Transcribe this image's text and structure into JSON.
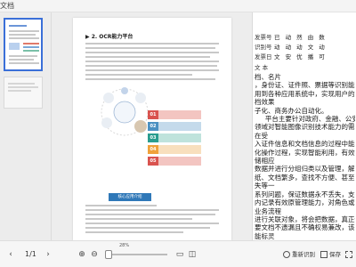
{
  "window": {
    "title": "文档"
  },
  "document": {
    "heading": "▶ 2. OCR能力平台",
    "blue_label": "核心应用介绍",
    "bars": [
      {
        "num": "01",
        "color": "#d9534f"
      },
      {
        "num": "02",
        "color": "#4a90c2"
      },
      {
        "num": "03",
        "color": "#2a9d8f"
      },
      {
        "num": "04",
        "color": "#f0a23b"
      },
      {
        "num": "05",
        "color": "#d9534f"
      }
    ]
  },
  "ocr": {
    "fields": [
      {
        "label": "发票号",
        "values": "已 动 然 由 数"
      },
      {
        "label": "识别号",
        "values": "动 动 动 文 动"
      },
      {
        "label": "发票日",
        "values": "文 安 优 播 可"
      }
    ],
    "text_label": "文 本",
    "text_lines": [
      "档、名片",
      "，身份证、证件照、票据等识别能力",
      "用到各种应用系统中，实现用户的文",
      "档效果",
      "子化、商务办公自动化。",
      "     平台主要针对政府、金融、公安等",
      "领域对智能图像识别技术能力的需求",
      "在受",
      "入证件信息和文档信息的过程中能",
      "化操作过程，实现智能利用，有效提",
      "储相应",
      "数据并进行分组归类以及管理，解决",
      "纸、文档繁多，查找不方便、甚至",
      "失等一",
      "系列问题，保证数据永不丢失，支持",
      "内记录有效原管理能力，对角色或",
      "业务流程",
      "进行关联对象，将会把数据，真正做",
      "要文档不遗漏且不确权易兼改，该平",
      "能标灵",
      "活跳选、组合应用，向上对系统集成",
      "的平台中。",
      "     实现多种资料电子化"
    ]
  },
  "toolbar": {
    "page_indicator": "1/1",
    "zoom_label": "28%",
    "zoom_fraction": 0.0,
    "rerecognize": "重新识别",
    "save": "保存",
    "fullscreen": "全屏"
  }
}
